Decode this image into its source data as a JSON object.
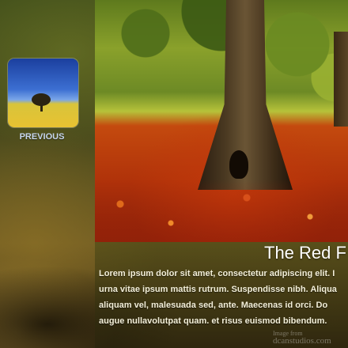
{
  "navigation": {
    "previous_label": "PREVIOUS"
  },
  "slide": {
    "title": "The Red F",
    "caption_lines": [
      "Lorem ipsum dolor sit amet, consectetur adipiscing elit. I",
      "urna vitae ipsum mattis rutrum. Suspendisse nibh. Aliqua",
      "aliquam vel, malesuada sed, ante. Maecenas id orci. Do",
      "augue nullavolutpat quam. et risus euismod bibendum."
    ],
    "image_credit_line1": "Image from",
    "image_credit_line2": "dcanstudios.com"
  },
  "colors": {
    "caption_text": "#f3efd9",
    "previous_text": "#c7d6ee",
    "title_text": "#ffffff"
  },
  "icons": {
    "thumbnail": "previous-slide-thumbnail"
  }
}
